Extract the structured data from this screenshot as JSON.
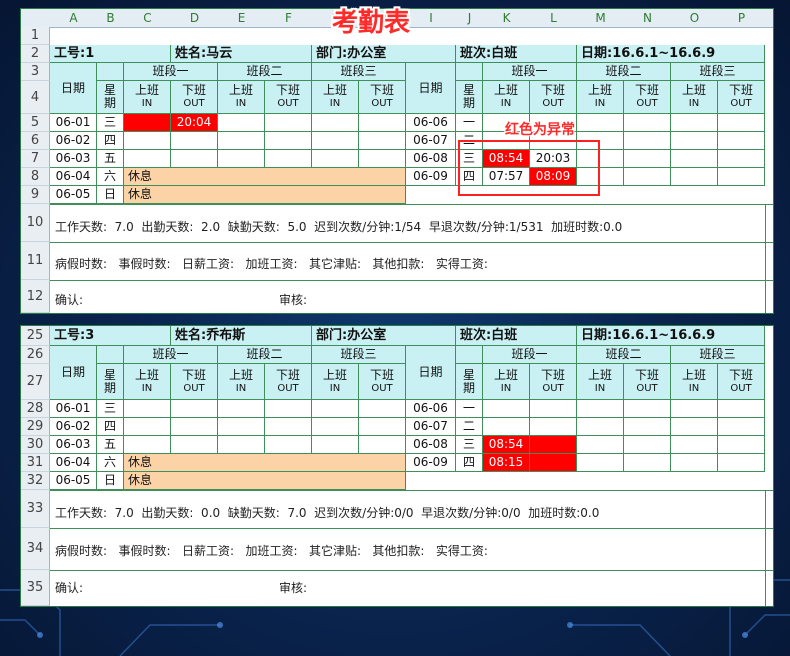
{
  "title": "考勤表",
  "note": "红色为异常",
  "columns": [
    "A",
    "B",
    "C",
    "D",
    "E",
    "F",
    "G",
    "H",
    "I",
    "J",
    "K",
    "L",
    "M",
    "N",
    "O",
    "P"
  ],
  "labels": {
    "date": "日期",
    "weekday": "星期",
    "on_duty": "上班",
    "off_duty": "下班",
    "in": "IN",
    "out": "OUT",
    "shift1": "班段一",
    "shift2": "班段二",
    "shift3": "班段三",
    "confirm": "确认:",
    "review": "审核:",
    "rest": "休息"
  },
  "sheet1": {
    "row_numbers": [
      "1",
      "2",
      "3",
      "4",
      "5",
      "6",
      "7",
      "8",
      "9",
      "10",
      "11",
      "12"
    ],
    "emp_id": "工号:1",
    "name": "姓名:马云",
    "dept": "部门:办公室",
    "shift": "班次:白班",
    "date_range": "日期:16.6.1~16.6.9",
    "left_rows": [
      {
        "date": "06-01",
        "wd": "三",
        "in": "",
        "out": "20:04"
      },
      {
        "date": "06-02",
        "wd": "四",
        "in": "",
        "out": ""
      },
      {
        "date": "06-03",
        "wd": "五",
        "in": "",
        "out": ""
      },
      {
        "date": "06-04",
        "wd": "六",
        "rest": "休息"
      },
      {
        "date": "06-05",
        "wd": "日",
        "rest": "休息"
      }
    ],
    "right_rows": [
      {
        "date": "06-06",
        "wd": "一",
        "in": "",
        "out": ""
      },
      {
        "date": "06-07",
        "wd": "二",
        "in": "",
        "out": ""
      },
      {
        "date": "06-08",
        "wd": "三",
        "in": "08:54",
        "out": "20:03"
      },
      {
        "date": "06-09",
        "wd": "四",
        "in": "07:57",
        "out": "08:09"
      }
    ],
    "stats_line1": "工作天数:  7.0  出勤天数:  2.0  缺勤天数:  5.0  迟到次数/分钟:1/54  早退次数/分钟:1/531  加班时数:0.0",
    "stats_line2": "病假时数:   事假时数:   日薪工资:   加班工资:   其它津贴:   其他扣款:   实得工资:"
  },
  "sheet2": {
    "row_numbers": [
      "25",
      "26",
      "27",
      "28",
      "29",
      "30",
      "31",
      "32",
      "33",
      "34",
      "35"
    ],
    "emp_id": "工号:3",
    "name": "姓名:乔布斯",
    "dept": "部门:办公室",
    "shift": "班次:白班",
    "date_range": "日期:16.6.1~16.6.9",
    "left_rows": [
      {
        "date": "06-01",
        "wd": "三",
        "in": "",
        "out": ""
      },
      {
        "date": "06-02",
        "wd": "四",
        "in": "",
        "out": ""
      },
      {
        "date": "06-03",
        "wd": "五",
        "in": "",
        "out": ""
      },
      {
        "date": "06-04",
        "wd": "六",
        "rest": "休息"
      },
      {
        "date": "06-05",
        "wd": "日",
        "rest": "休息"
      }
    ],
    "right_rows": [
      {
        "date": "06-06",
        "wd": "一",
        "in": "",
        "out": ""
      },
      {
        "date": "06-07",
        "wd": "二",
        "in": "",
        "out": ""
      },
      {
        "date": "06-08",
        "wd": "三",
        "in": "08:54",
        "out": ""
      },
      {
        "date": "06-09",
        "wd": "四",
        "in": "08:15",
        "out": ""
      }
    ],
    "stats_line1": "工作天数:  7.0  出勤天数:  0.0  缺勤天数:  7.0  迟到次数/分钟:0/0  早退次数/分钟:0/0  加班时数:0.0",
    "stats_line2": "病假时数:   事假时数:   日薪工资:   加班工资:   其它津贴:   其他扣款:   实得工资:"
  },
  "colors": {
    "header_fill": "#c9f0f3",
    "rest_fill": "#fbd3a6",
    "abnormal_fill": "#ff0000",
    "grid": "#3e8f5a",
    "title": "#ff2a2a"
  }
}
